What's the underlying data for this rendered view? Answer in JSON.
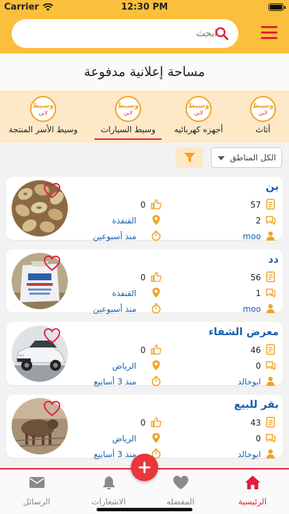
{
  "status": {
    "carrier": "Carrier",
    "time": "12:30 PM"
  },
  "search": {
    "placeholder": "ابحث"
  },
  "ad_banner": {
    "text": "مساحة إعلانية مدفوعة"
  },
  "categories": [
    {
      "label": "أثاث",
      "logo_text": "وسيط",
      "logo_sub": "لاين",
      "selected": false
    },
    {
      "label": "أجهزه كهربائيه",
      "logo_text": "وسيط",
      "logo_sub": "لاين",
      "selected": false
    },
    {
      "label": "وسيط السيارات",
      "logo_text": "وسيط",
      "logo_sub": "لاين",
      "selected": true
    },
    {
      "label": "وسيط الأسر المنتجة",
      "logo_text": "وسيط",
      "logo_sub": "لاين",
      "selected": false
    }
  ],
  "filters": {
    "region": "الكل المناطق"
  },
  "listings": [
    {
      "title": "بن",
      "views": "57",
      "comments": "2",
      "user": "moo",
      "likes": "0",
      "location": "القنفذة",
      "time": "منذ أسبوعين",
      "image": "pistachios",
      "favorited": false
    },
    {
      "title": "دد",
      "views": "56",
      "comments": "1",
      "user": "moo",
      "likes": "0",
      "location": "القنفذة",
      "time": "منذ أسبوعين",
      "image": "sack",
      "favorited": false
    },
    {
      "title": "معرض الشفاء",
      "views": "46",
      "comments": "0",
      "user": "ابوخالد",
      "likes": "0",
      "location": "الرياض",
      "time": "منذ 3 أسابيع",
      "image": "car",
      "favorited": false
    },
    {
      "title": "بقر للبيع",
      "views": "43",
      "comments": "0",
      "user": "ابوخالد",
      "likes": "0",
      "location": "الرياض",
      "time": "منذ 3 أسابيع",
      "image": "cattle",
      "favorited": false
    }
  ],
  "tabbar": {
    "home": "الرئيسية",
    "favorites": "المفضله",
    "notifications": "الاشعارات",
    "messages": "الرسائل",
    "active": "home"
  },
  "colors": {
    "primary": "#fbbf3b",
    "accent": "#e01f3d",
    "link": "#1a5fb0",
    "icon": "#f0a427"
  }
}
